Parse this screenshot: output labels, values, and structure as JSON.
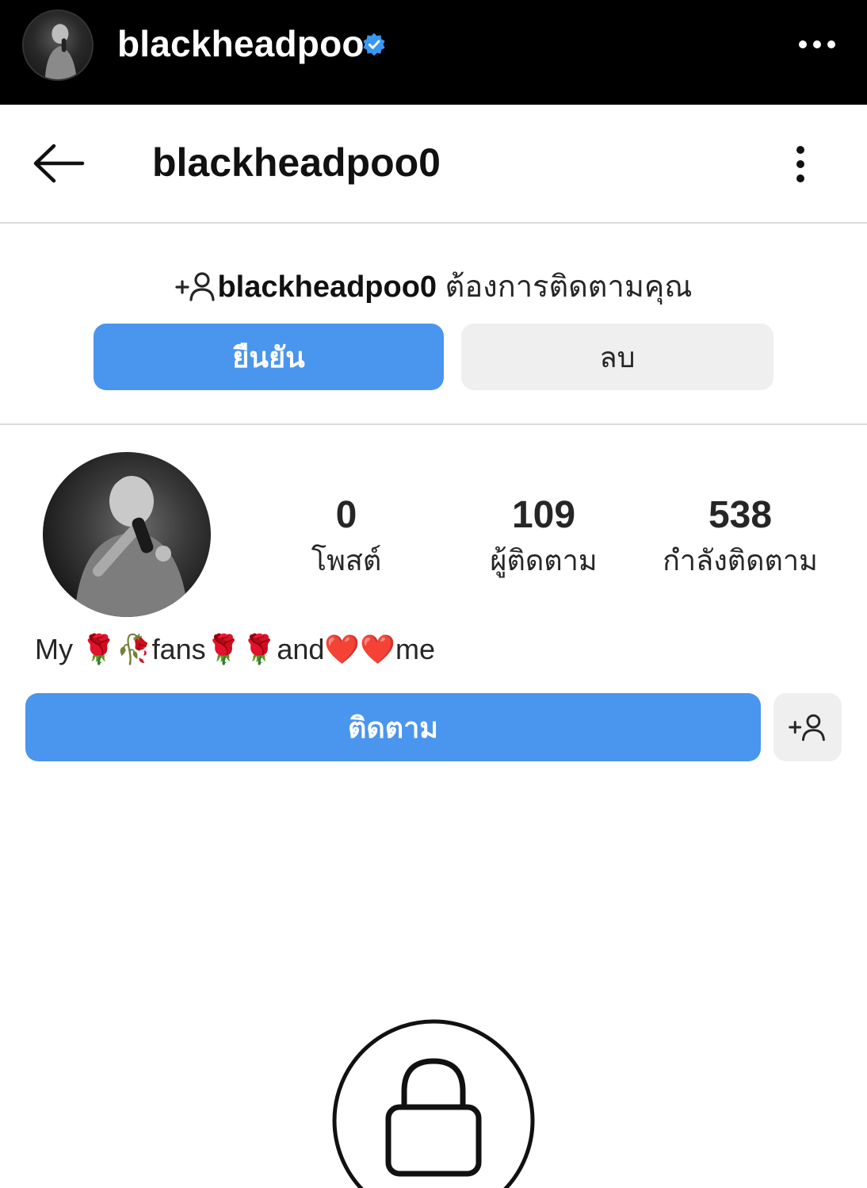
{
  "story_header": {
    "username": "blackheadpoo",
    "verified": true,
    "icons": {
      "avatar": "profile-photo",
      "verified": "verified-badge-icon",
      "more": "more-horizontal-icon"
    }
  },
  "nav": {
    "title": "blackheadpoo0",
    "icons": {
      "back": "back-arrow-icon",
      "more": "more-vertical-icon"
    }
  },
  "follow_request": {
    "username": "blackheadpoo0",
    "message": " ต้องการติดตามคุณ",
    "confirm_label": "ยืนยัน",
    "delete_label": "ลบ",
    "icon": "add-person-icon"
  },
  "profile": {
    "stats": [
      {
        "value": "0",
        "label": "โพสต์"
      },
      {
        "value": "109",
        "label": "ผู้ติดตาม"
      },
      {
        "value": "538",
        "label": "กำลังติดตาม"
      }
    ],
    "bio": "My 🌹🥀fans🌹🌹and❤️❤️me",
    "follow_label": "ติดตาม",
    "icons": {
      "suggest": "add-person-icon",
      "private": "lock-icon"
    }
  },
  "colors": {
    "accent": "#4a95ee",
    "verified": "#3897f0",
    "secondary_button": "#efefef",
    "top_bar": "#000000"
  }
}
